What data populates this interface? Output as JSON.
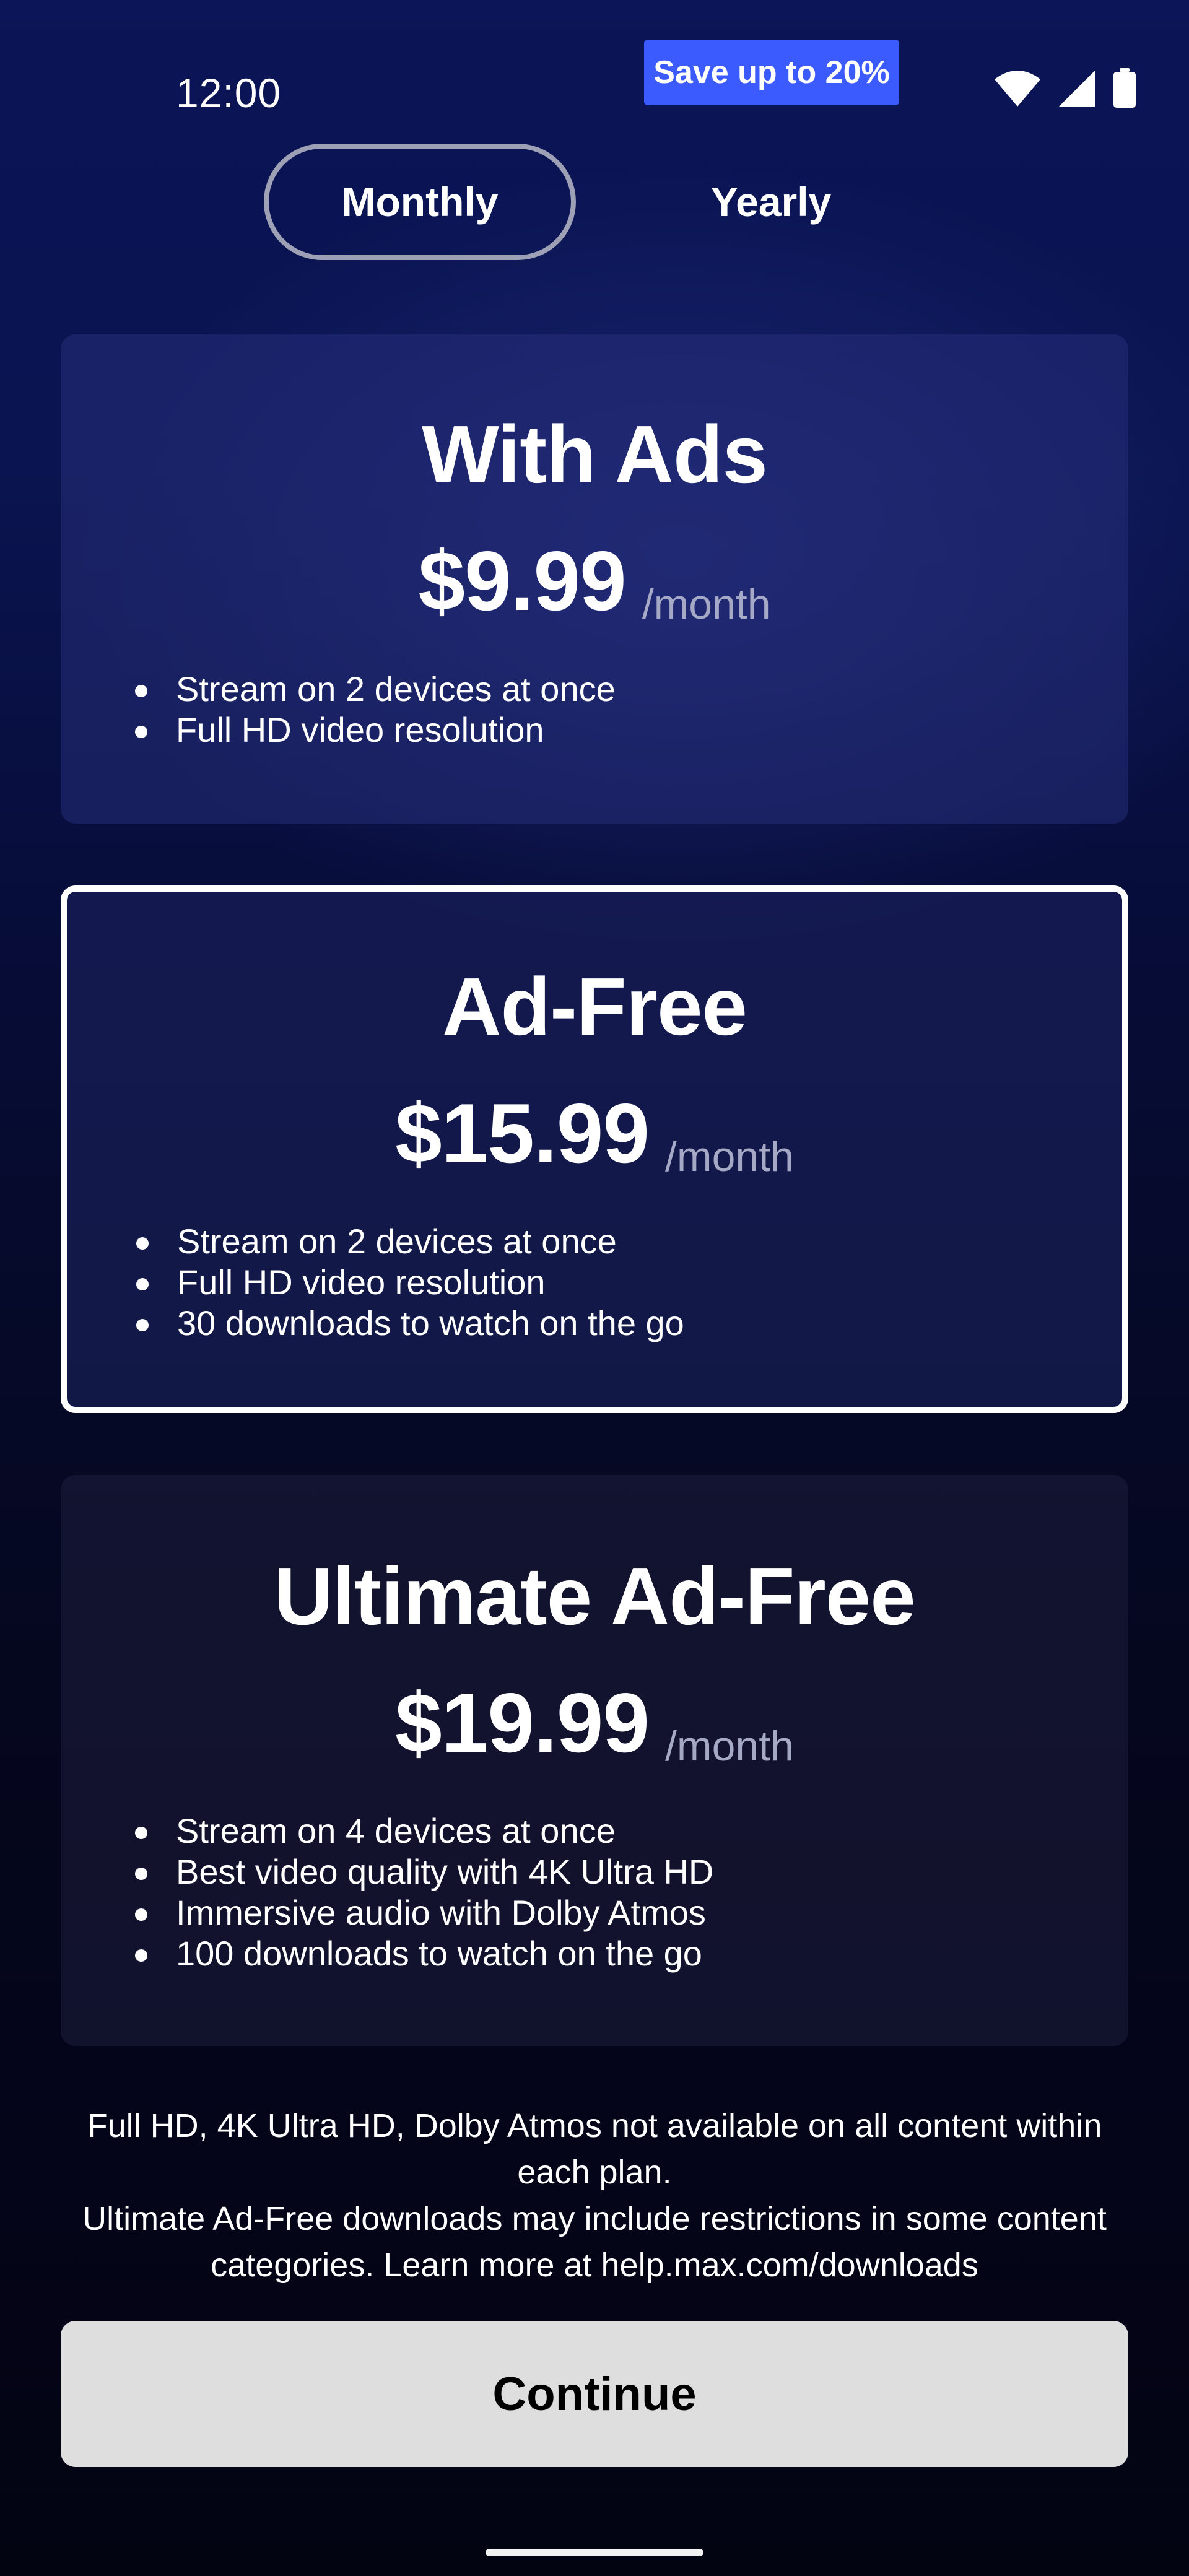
{
  "status_bar": {
    "time": "12:00",
    "icons": [
      "wifi-icon",
      "cellular-signal-icon",
      "battery-icon"
    ]
  },
  "promo_badge": "Save up to 20%",
  "billing_toggle": {
    "monthly_label": "Monthly",
    "yearly_label": "Yearly",
    "selected": "Monthly"
  },
  "plans": [
    {
      "name": "With Ads",
      "price": "$9.99",
      "period": "/month",
      "selected": false,
      "features": [
        "Stream on 2 devices at once",
        "Full HD video resolution"
      ]
    },
    {
      "name": "Ad-Free",
      "price": "$15.99",
      "period": "/month",
      "selected": true,
      "features": [
        "Stream on 2 devices at once",
        "Full HD video resolution",
        "30 downloads to watch on the go"
      ]
    },
    {
      "name": "Ultimate Ad-Free",
      "price": "$19.99",
      "period": "/month",
      "selected": false,
      "features": [
        "Stream on 4 devices at once",
        "Best video quality with 4K Ultra HD",
        "Immersive audio with Dolby Atmos",
        "100 downloads to watch on the go"
      ]
    }
  ],
  "disclaimer": {
    "line1": "Full HD, 4K Ultra HD, Dolby Atmos not available on all content within each plan.",
    "line2": "Ultimate Ad-Free downloads may include restrictions in some content categories. Learn more at help.max.com/downloads"
  },
  "continue_label": "Continue",
  "colors": {
    "promo_badge_bg": "#3b5bff",
    "continue_bg": "#dedede",
    "selected_border": "#ffffff",
    "period_text": "#a6a9c6"
  }
}
